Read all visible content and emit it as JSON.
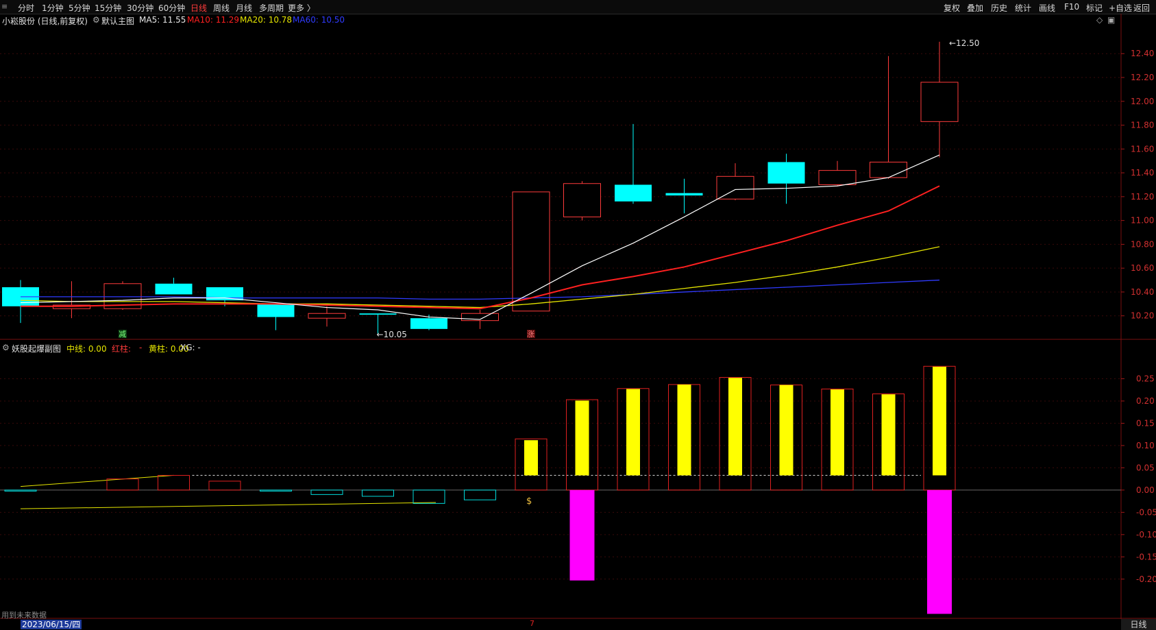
{
  "toolbar": {
    "left": [
      "分时",
      "1分钟",
      "5分钟",
      "15分钟",
      "30分钟",
      "60分钟",
      "日线",
      "周线",
      "月线",
      "多周期",
      "更多 〉"
    ],
    "active": "日线",
    "right": [
      "复权",
      "叠加",
      "历史",
      "统计",
      "画线",
      "F10",
      "标记",
      "+自选",
      "返回"
    ]
  },
  "main_header": {
    "stock": "小崧股份 (日线,前复权)",
    "template": "默认主图",
    "ma5": "MA5: 11.55",
    "ma10": "MA10: 11.29",
    "ma20": "MA20: 10.78",
    "ma60": "MA60: 10.50"
  },
  "sub_header": {
    "name": "妖股起爆副图",
    "zx": "中线: 0.00",
    "hz_label": "红柱:",
    "hz_value": "-",
    "yz": "黄柱: 0.00",
    "xg": "XG: -"
  },
  "annotations": {
    "high_label": "12.50",
    "low_label": "10.05",
    "minus_badge": "减",
    "plus_badge": "涨"
  },
  "footer": {
    "note": "用到未来数据",
    "date": "2023/06/15/四",
    "month_mark": "7",
    "period_tab": "日线"
  },
  "colors": {
    "up": "#ff3b3b",
    "down": "#00ffff",
    "ma5": "#ffffff",
    "ma10": "#ff2020",
    "ma20": "#e6e600",
    "ma60": "#2f3bff",
    "hz": "#ff00ff",
    "yz": "#ffff00"
  },
  "chart_data": [
    {
      "type": "candlestick",
      "yticks": [
        "12.40",
        "12.20",
        "12.00",
        "11.80",
        "11.60",
        "11.40",
        "11.20",
        "11.00",
        "10.80",
        "10.60",
        "10.40",
        "10.20"
      ],
      "ylim": [
        10.02,
        12.62
      ],
      "candles": [
        {
          "o": 10.44,
          "h": 10.5,
          "l": 10.14,
          "c": 10.28
        },
        {
          "o": 10.26,
          "h": 10.49,
          "l": 10.18,
          "c": 10.29
        },
        {
          "o": 10.26,
          "h": 10.49,
          "l": 10.25,
          "c": 10.47
        },
        {
          "o": 10.47,
          "h": 10.52,
          "l": 10.38,
          "c": 10.38
        },
        {
          "o": 10.44,
          "h": 10.44,
          "l": 10.28,
          "c": 10.33
        },
        {
          "o": 10.3,
          "h": 10.3,
          "l": 10.08,
          "c": 10.19
        },
        {
          "o": 10.18,
          "h": 10.28,
          "l": 10.11,
          "c": 10.22
        },
        {
          "o": 10.22,
          "h": 10.22,
          "l": 10.05,
          "c": 10.21
        },
        {
          "o": 10.18,
          "h": 10.21,
          "l": 10.08,
          "c": 10.09
        },
        {
          "o": 10.16,
          "h": 10.25,
          "l": 10.09,
          "c": 10.22
        },
        {
          "o": 10.24,
          "h": 11.24,
          "l": 10.24,
          "c": 11.24
        },
        {
          "o": 11.03,
          "h": 11.33,
          "l": 11.0,
          "c": 11.31
        },
        {
          "o": 11.3,
          "h": 11.81,
          "l": 11.14,
          "c": 11.16
        },
        {
          "o": 11.23,
          "h": 11.35,
          "l": 11.06,
          "c": 11.21
        },
        {
          "o": 11.18,
          "h": 11.48,
          "l": 11.17,
          "c": 11.37
        },
        {
          "o": 11.49,
          "h": 11.56,
          "l": 11.14,
          "c": 11.31
        },
        {
          "o": 11.3,
          "h": 11.5,
          "l": 11.29,
          "c": 11.42
        },
        {
          "o": 11.36,
          "h": 12.38,
          "l": 11.35,
          "c": 11.49
        },
        {
          "o": 11.83,
          "h": 12.5,
          "l": 11.53,
          "c": 12.16
        }
      ],
      "ma5": [
        10.31,
        10.32,
        10.33,
        10.35,
        10.35,
        10.31,
        10.27,
        10.25,
        10.19,
        10.17,
        10.39,
        10.62,
        10.81,
        11.03,
        11.26,
        11.27,
        11.29,
        11.36,
        11.55
      ],
      "ma10": [
        10.28,
        10.28,
        10.29,
        10.3,
        10.3,
        10.3,
        10.29,
        10.28,
        10.27,
        10.26,
        10.35,
        10.46,
        10.53,
        10.61,
        10.72,
        10.83,
        10.96,
        11.08,
        11.29
      ],
      "ma20": [
        10.33,
        10.32,
        10.32,
        10.32,
        10.31,
        10.3,
        10.3,
        10.29,
        10.28,
        10.27,
        10.3,
        10.34,
        10.38,
        10.43,
        10.48,
        10.54,
        10.61,
        10.69,
        10.78
      ],
      "ma60": [
        10.36,
        10.36,
        10.36,
        10.36,
        10.35,
        10.35,
        10.35,
        10.35,
        10.34,
        10.34,
        10.35,
        10.36,
        10.38,
        10.4,
        10.42,
        10.44,
        10.46,
        10.48,
        10.5
      ]
    },
    {
      "type": "bar",
      "yticks": [
        "0.25",
        "0.20",
        "0.15",
        "0.10",
        "0.05",
        "0.00",
        "-0.05",
        "-0.10",
        "-0.15",
        "-0.20"
      ],
      "ylim": [
        -0.285,
        0.3
      ],
      "red_bars": [
        0.0,
        0.0,
        0.025,
        0.033,
        0.02,
        0.0,
        0.0,
        0.0,
        0.0,
        0.0,
        0.115,
        0.203,
        0.228,
        0.237,
        0.253,
        0.236,
        0.227,
        0.216,
        0.278
      ],
      "cyan_bars": [
        -0.002,
        0.0,
        0.0,
        0.0,
        0.0,
        -0.001,
        -0.01,
        -0.014,
        -0.03,
        -0.022,
        0,
        0,
        0,
        0,
        0,
        0,
        0,
        0,
        0
      ],
      "yellow_bars": [
        0,
        0,
        0,
        0,
        0,
        0,
        0,
        0,
        0,
        0,
        0.112,
        0.201,
        0.227,
        0.237,
        0.252,
        0.236,
        0.226,
        0.215,
        0.277
      ],
      "magenta_bars": [
        0,
        0,
        0,
        0,
        0,
        0,
        0,
        0,
        0,
        0,
        0,
        -0.203,
        0,
        0,
        0,
        0,
        0,
        0,
        -0.278
      ],
      "dotted_level": 0.033,
      "line_upper": [
        0.008,
        0.033
      ],
      "line_lower": [
        -0.042,
        -0.028
      ]
    }
  ]
}
